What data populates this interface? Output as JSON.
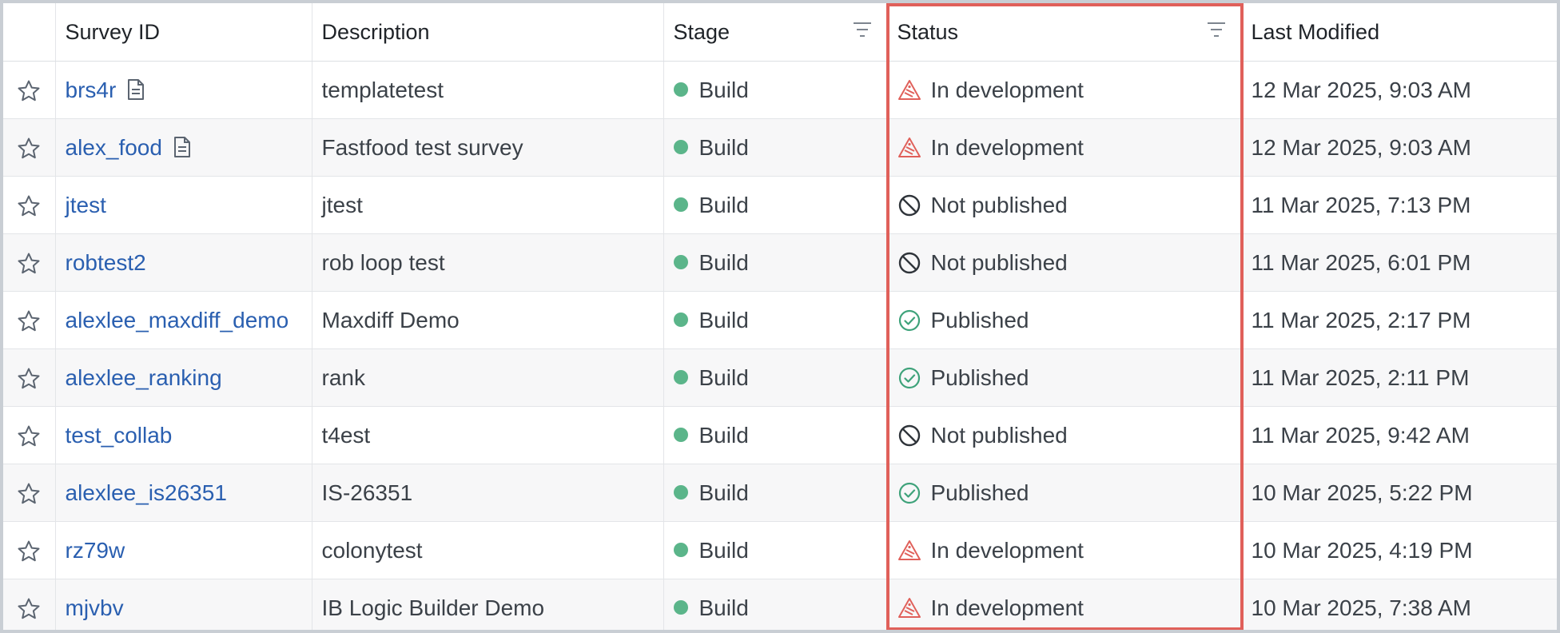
{
  "table": {
    "columns": {
      "survey_id": "Survey ID",
      "description": "Description",
      "stage": "Stage",
      "status": "Status",
      "last_modified": "Last Modified"
    },
    "rows": [
      {
        "id": "brs4r",
        "has_doc": true,
        "description": "templatetest",
        "stage": "Build",
        "status": "In development",
        "status_kind": "dev",
        "modified": "12 Mar 2025, 9:03 AM"
      },
      {
        "id": "alex_food",
        "has_doc": true,
        "description": "Fastfood test survey",
        "stage": "Build",
        "status": "In development",
        "status_kind": "dev",
        "modified": "12 Mar 2025, 9:03 AM"
      },
      {
        "id": "jtest",
        "has_doc": false,
        "description": "jtest",
        "stage": "Build",
        "status": "Not published",
        "status_kind": "not",
        "modified": "11 Mar 2025, 7:13 PM"
      },
      {
        "id": "robtest2",
        "has_doc": false,
        "description": "rob loop test",
        "stage": "Build",
        "status": "Not published",
        "status_kind": "not",
        "modified": "11 Mar 2025, 6:01 PM"
      },
      {
        "id": "alexlee_maxdiff_demo",
        "has_doc": false,
        "description": "Maxdiff Demo",
        "stage": "Build",
        "status": "Published",
        "status_kind": "pub",
        "modified": "11 Mar 2025, 2:17 PM"
      },
      {
        "id": "alexlee_ranking",
        "has_doc": false,
        "description": "rank",
        "stage": "Build",
        "status": "Published",
        "status_kind": "pub",
        "modified": "11 Mar 2025, 2:11 PM"
      },
      {
        "id": "test_collab",
        "has_doc": false,
        "description": "t4est",
        "stage": "Build",
        "status": "Not published",
        "status_kind": "not",
        "modified": "11 Mar 2025, 9:42 AM"
      },
      {
        "id": "alexlee_is26351",
        "has_doc": false,
        "description": "IS-26351",
        "stage": "Build",
        "status": "Published",
        "status_kind": "pub",
        "modified": "10 Mar 2025, 5:22 PM"
      },
      {
        "id": "rz79w",
        "has_doc": false,
        "description": "colonytest",
        "stage": "Build",
        "status": "In development",
        "status_kind": "dev",
        "modified": "10 Mar 2025, 4:19 PM"
      },
      {
        "id": "mjvbv",
        "has_doc": false,
        "description": "IB Logic Builder Demo",
        "stage": "Build",
        "status": "In development",
        "status_kind": "dev",
        "modified": "10 Mar 2025, 7:38 AM"
      }
    ]
  },
  "colors": {
    "link": "#2a5fb0",
    "stage_dot": "#5bb58a",
    "highlight": "#e0605a",
    "dev_icon": "#e0605a",
    "published_icon": "#3ea27a",
    "not_published_icon": "#2f343a"
  },
  "icons": {
    "star": "star-outline-icon",
    "doc": "document-icon",
    "filter": "filter-icon",
    "dev": "in-development-icon",
    "not": "not-published-icon",
    "pub": "published-check-icon"
  }
}
